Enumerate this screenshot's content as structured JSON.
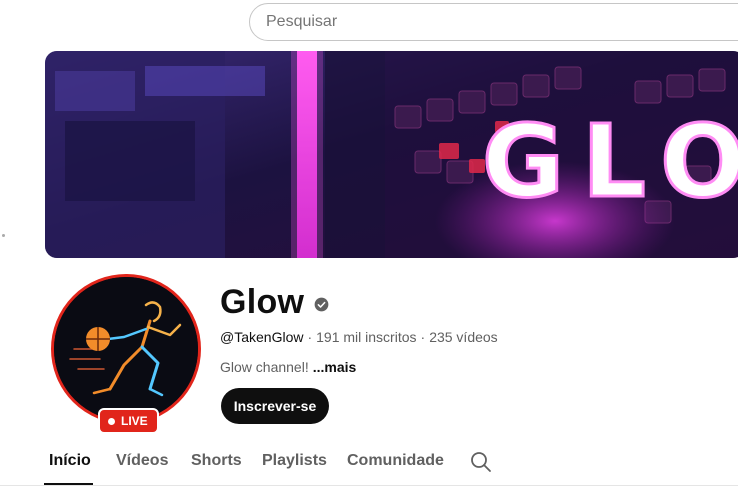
{
  "search": {
    "placeholder": "Pesquisar"
  },
  "channel": {
    "name": "Glow",
    "handle": "@TakenGlow",
    "subscribers": "191 mil inscritos",
    "videos": "235 vídeos",
    "separator": "·",
    "description": "Glow channel!",
    "more_label": "...mais",
    "subscribe_label": "Inscrever-se",
    "live_label": "LIVE",
    "banner_text": "GLO"
  },
  "tabs": [
    {
      "label": "Início"
    },
    {
      "label": "Vídeos"
    },
    {
      "label": "Shorts"
    },
    {
      "label": "Playlists"
    },
    {
      "label": "Comunidade"
    }
  ],
  "icons": {
    "verified": "verified-icon",
    "tab_search": "search-icon",
    "live": "live-dot-icon"
  },
  "colors": {
    "live_red": "#e1251b",
    "subscribe_bg": "#0f0f0f",
    "banner_bg": "#23154a",
    "banner_accent": "#ff3de0"
  }
}
